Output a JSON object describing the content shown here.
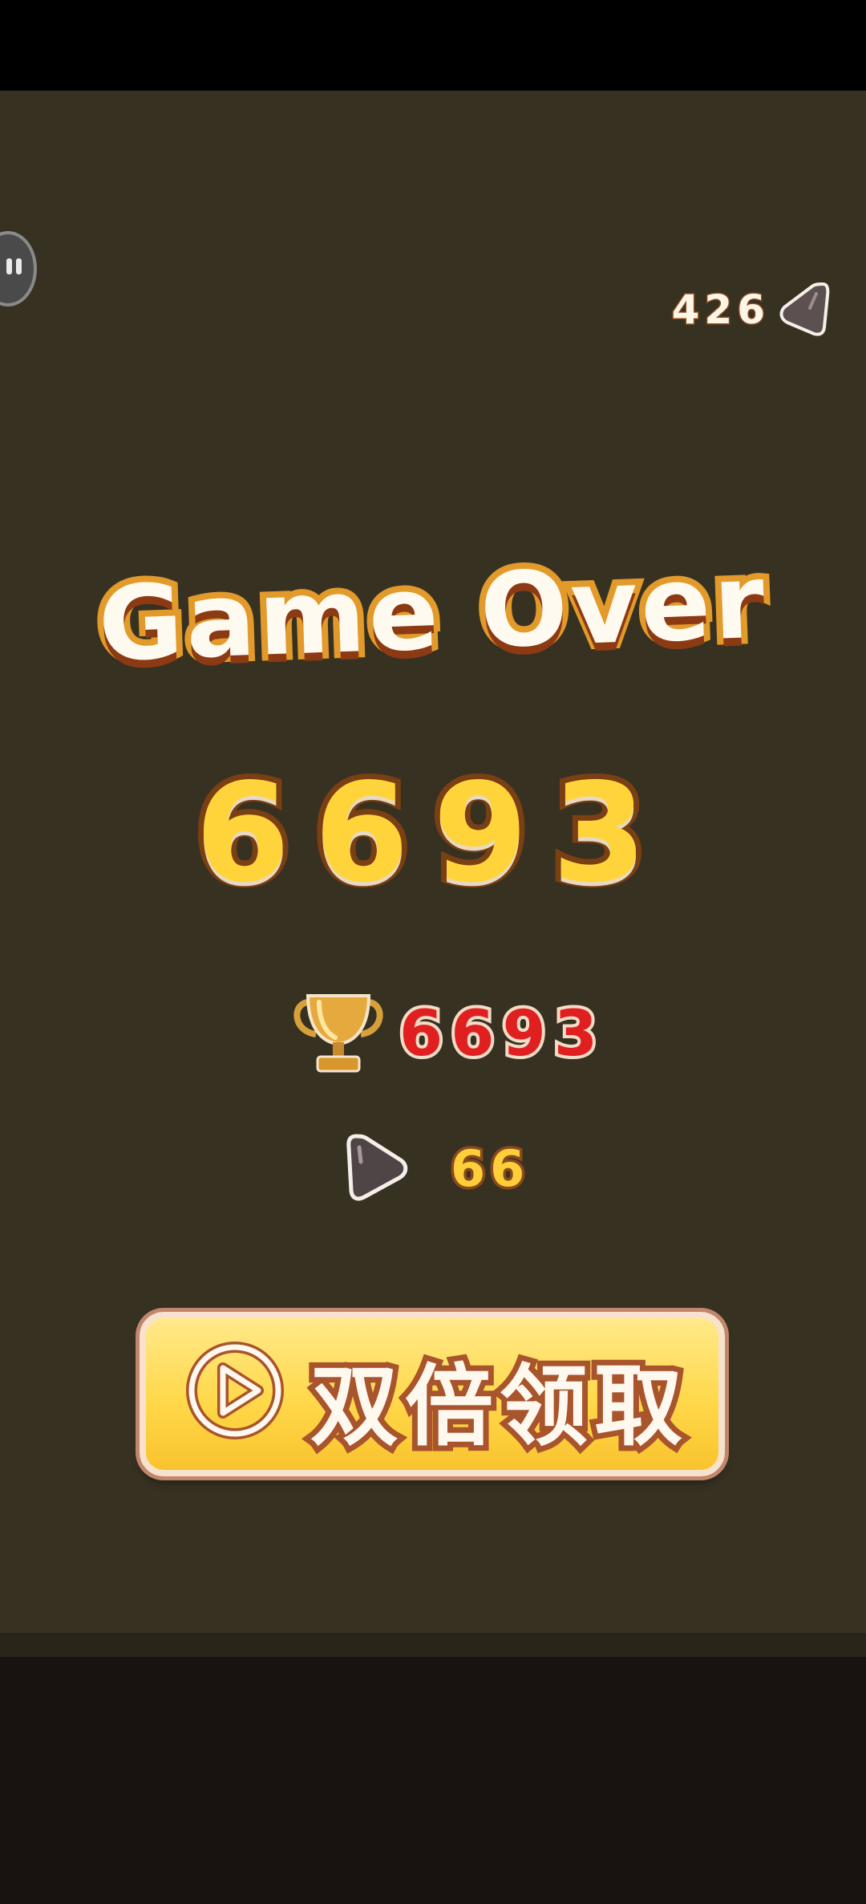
{
  "hud": {
    "coin_count": "426",
    "coin_icon": "gem-icon",
    "pause_icon": "pause-icon"
  },
  "result": {
    "title": "Game Over",
    "score": "6693",
    "best_score": "6693",
    "best_icon": "trophy-icon",
    "reward_amount": "66",
    "reward_icon": "gem-icon"
  },
  "actions": {
    "double_reward_label": "双倍领取",
    "double_reward_icon": "play-icon"
  },
  "colors": {
    "background": "#373122",
    "score_fill": "#ffd43b",
    "best_score_fill": "#e02020",
    "button_fill": "#ffd84a"
  }
}
